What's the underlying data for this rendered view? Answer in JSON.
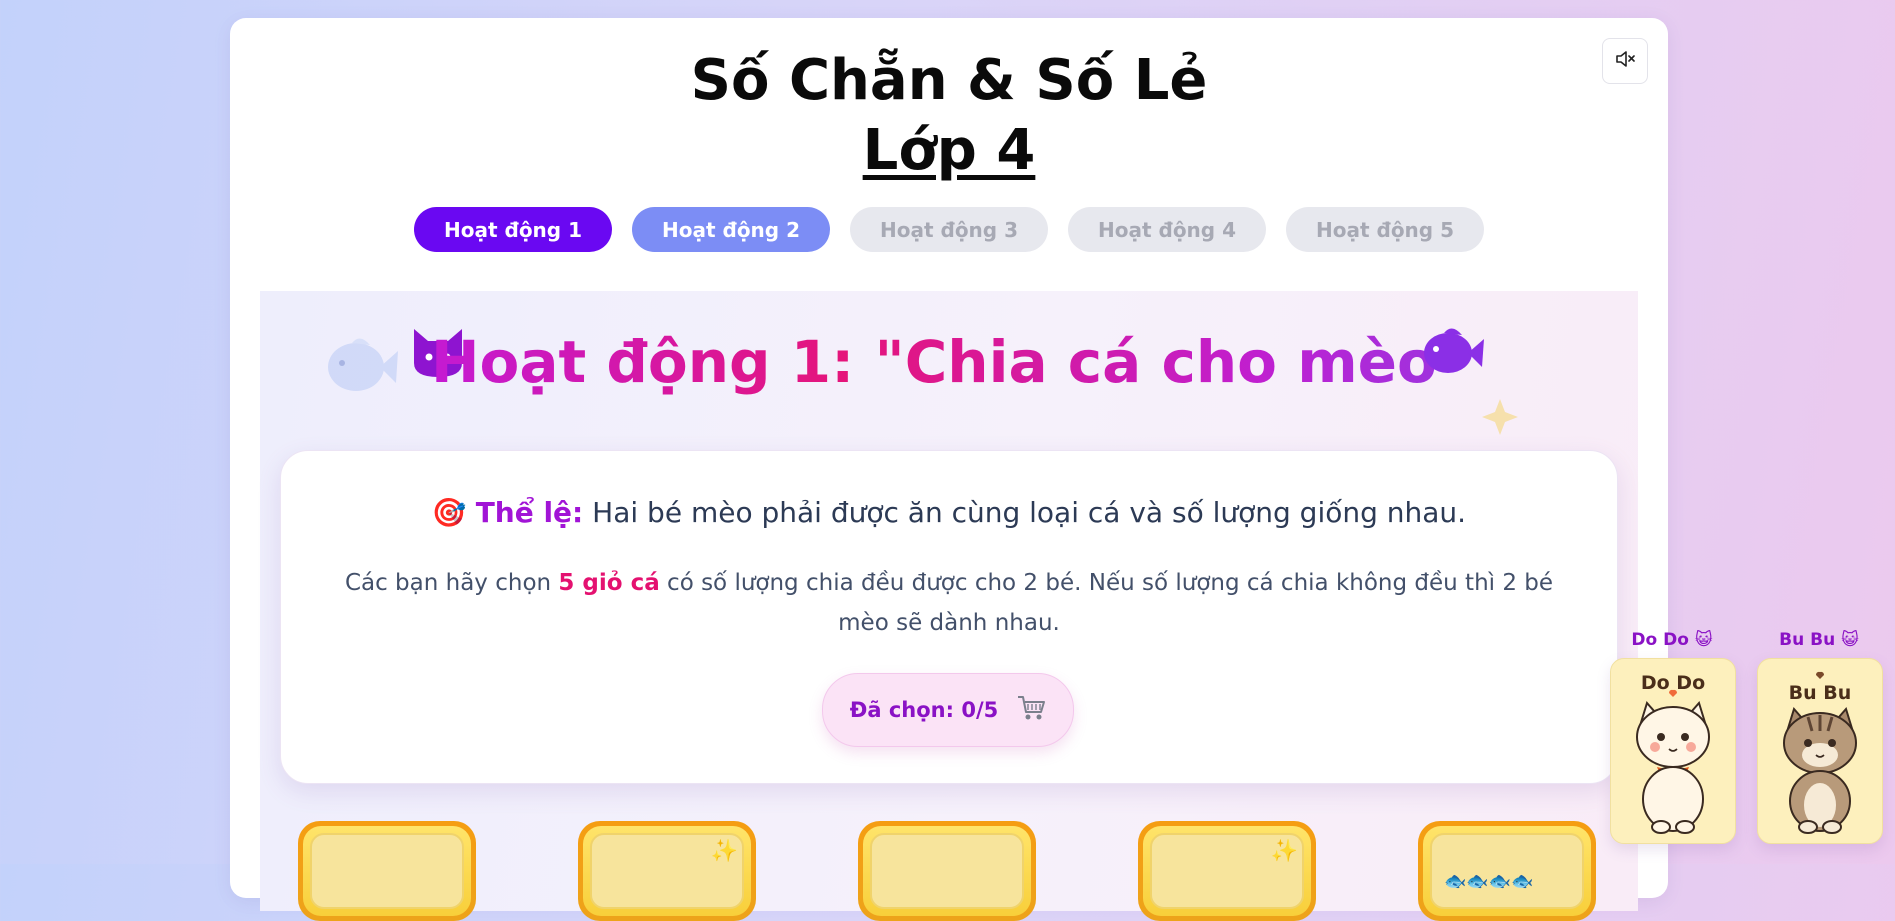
{
  "header": {
    "title": "Số Chẵn & Số Lẻ",
    "subtitle": "Lớp 4",
    "mute_icon": "speaker-muted-icon"
  },
  "tabs": [
    {
      "label": "Hoạt động 1",
      "state": "active"
    },
    {
      "label": "Hoạt động 2",
      "state": "available"
    },
    {
      "label": "Hoạt động 3",
      "state": "locked"
    },
    {
      "label": "Hoạt động 4",
      "state": "locked"
    },
    {
      "label": "Hoạt động 5",
      "state": "locked"
    }
  ],
  "activity": {
    "title": "Hoạt động 1: \"Chia cá cho mèo\"",
    "rule_icon": "🎯",
    "rule_label": "Thể lệ:",
    "rule_text": " Hai bé mèo phải được ăn cùng loại cá và số lượng giống nhau.",
    "instruction_pre": "Các bạn hãy chọn ",
    "instruction_highlight": "5 giỏ cá",
    "instruction_post": " có số lượng chia đều được cho 2 bé. Nếu số lượng cá chia không đều thì 2 bé mèo sẽ dành nhau.",
    "counter_label": "Đã chọn: 0/5",
    "counter_icon": "🛒"
  },
  "baskets": [
    {
      "deco": ""
    },
    {
      "deco": "✨"
    },
    {
      "deco": ""
    },
    {
      "deco": "✨"
    },
    {
      "deco": "",
      "fish": "🐟🐟🐟🐟"
    }
  ],
  "pets": [
    {
      "name": "Do Do 😺",
      "sign": "Do Do"
    },
    {
      "name": "Bu Bu 😺",
      "sign": "Bu Bu"
    }
  ],
  "colors": {
    "tab_active": "#6a08f2",
    "tab_available": "#7c8df5",
    "tab_locked": "#e7e8ee",
    "accent_pink": "#e41170",
    "accent_purple": "#a114d6"
  }
}
